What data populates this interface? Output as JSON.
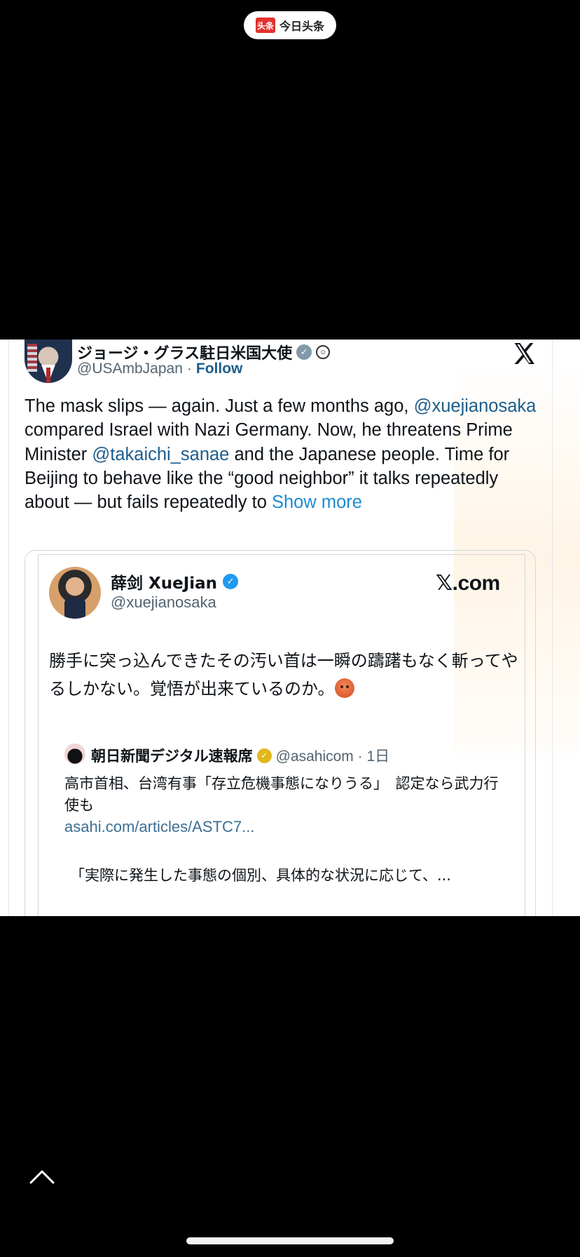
{
  "top_pill": {
    "logo_text": "头条",
    "app_name": "今日头条"
  },
  "tweet": {
    "author_name": "ジョージ・グラス駐日米国大使",
    "handle": "@USAmbJapan",
    "separator": "·",
    "follow_label": "Follow",
    "text_1": "The mask slips — again. Just a few months ago, ",
    "mention_1": "@xuejianosaka",
    "text_2": " compared Israel with Nazi Germany. Now, he threatens Prime Minister ",
    "mention_2": "@takaichi_sanae",
    "text_3": " and the Japanese people. Time for Beijing to behave like the “good neighbor” it talks repeatedly about — but fails repeatedly to ",
    "show_more": "Show more"
  },
  "quote": {
    "name": "薛剑 XueJian",
    "handle": "@xuejianosaka",
    "site_label": "𝕏.com",
    "text": "勝手に突っ込んできたその汚い首は一瞬の躊躇もなく斬ってやるしかない。覚悟が出来ているのか。"
  },
  "nested_quote": {
    "name": "朝日新聞デジタル速報席",
    "handle_time": "@asahicom · 1日",
    "body": "高市首相、台湾有事「存立危機事態になりうる」　認定なら武力行使も",
    "link": "asahi.com/articles/ASTC7...",
    "excerpt": "「実際に発生した事態の個別、具体的な状況に応じて、..."
  },
  "colors": {
    "link": "#1d5d8c",
    "show_more": "#1d8bd0",
    "verified_blue": "#1d9bf0",
    "verified_gold": "#e2b719",
    "verified_grey": "#829aab"
  }
}
